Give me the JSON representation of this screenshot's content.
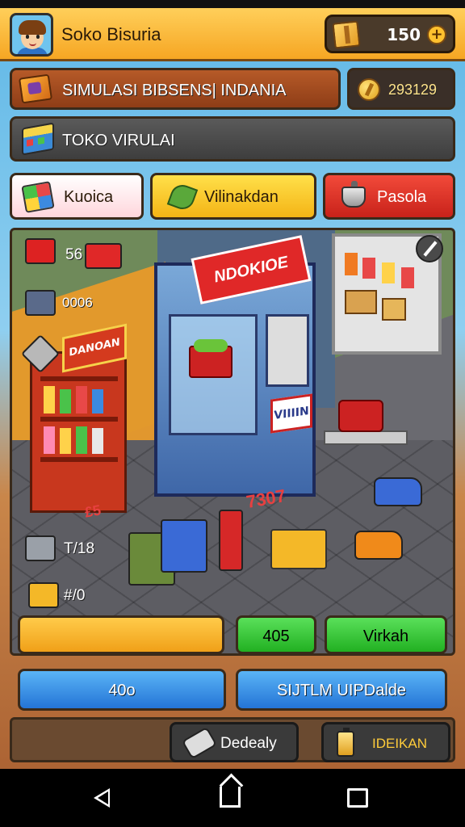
{
  "header": {
    "title": "Soko Bisuria",
    "coins": "150",
    "avatar_icon": "player-avatar-icon",
    "crate_icon": "crate-icon",
    "plus_icon": "plus-icon"
  },
  "banners": {
    "simulation": "SIMULASI BIBSENS| INDANIA",
    "money": "293129",
    "store": "TOKO VIRULAI"
  },
  "tabs": [
    {
      "label": "Kuoica",
      "icon": "cube-icon"
    },
    {
      "label": "Vilinakdan",
      "icon": "leaf-icon"
    },
    {
      "label": "Pasola",
      "icon": "pot-icon"
    }
  ],
  "scene": {
    "side_items": [
      {
        "label": "56",
        "icon": "cart-truck-icon"
      },
      {
        "label": "0006",
        "icon": "machine-icon"
      },
      {
        "label": "",
        "icon": "pyramid-icon"
      },
      {
        "label": "T/18",
        "icon": "register-icon"
      },
      {
        "label": "#/0",
        "icon": "box-icon"
      }
    ],
    "kiosk_sign": "NDOKIOE",
    "kiosk_panel": "VIIIIN",
    "shelf_sign": "DANOAN",
    "floor_number": "7307",
    "floor_small": "£5",
    "edit_icon": "edit-icon"
  },
  "actions": {
    "green_small": "405",
    "green_large": "Virkah",
    "blue_left": "40o",
    "blue_right": "SIJTLM UIPDalde"
  },
  "footer": {
    "btn_left": "Dedealy",
    "btn_right": "IDEIKAN"
  },
  "colors": {
    "header": "#f6a623",
    "tab_yellow": "#f4b416",
    "tab_red": "#c8221a",
    "green": "#22b022",
    "blue": "#2474d6"
  }
}
